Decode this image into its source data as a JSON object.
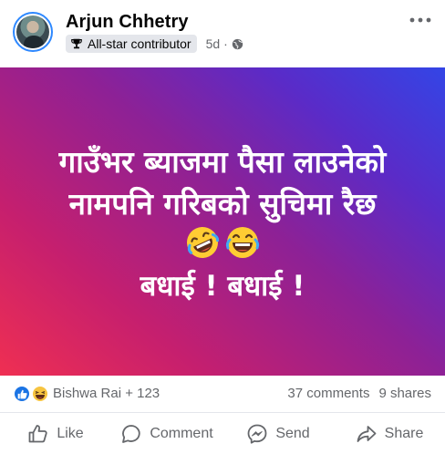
{
  "author": {
    "name": "Arjun Chhetry",
    "badge": "All-star contributor",
    "time": "5d",
    "separator": "·"
  },
  "post": {
    "line1": "गाउँभर ब्याजमा पैसा लाउनेको",
    "line2": "नामपनि गरिबको सुचिमा रैछ",
    "line3": "बधाई ! बधाई !",
    "emojis": [
      "rolling-on-floor-laughing-emoji",
      "grinning-tears-emoji"
    ],
    "gradient": [
      "#ef2f52",
      "#8d2196",
      "#3345e6"
    ]
  },
  "reactions": {
    "icons": [
      "like-icon",
      "haha-icon"
    ],
    "summary": "Bishwa Rai + 123",
    "comments": "37 comments",
    "shares": "9 shares"
  },
  "actions": {
    "like": "Like",
    "comment": "Comment",
    "send": "Send",
    "share": "Share"
  },
  "colors": {
    "accent": "#1b74e4",
    "secondary_text": "#65676b",
    "badge_bg": "#e4e6eb"
  }
}
